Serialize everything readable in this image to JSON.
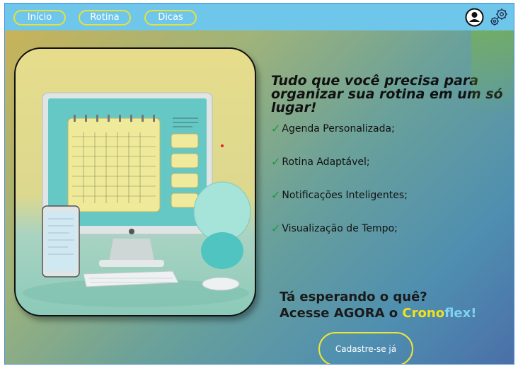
{
  "nav": {
    "items": [
      {
        "label": "Início"
      },
      {
        "label": "Rotina"
      },
      {
        "label": "Dicas"
      }
    ]
  },
  "icons": {
    "user": "user-account-icon",
    "settings": "gear-icon"
  },
  "hero": {
    "headline": "Tudo que você precisa para organizar sua rotina em um só lugar!",
    "features": [
      "Agenda Personalizada;",
      "Rotina Adaptável;",
      "Notificações Inteligentes;",
      "Visualização de Tempo;"
    ],
    "cta_line1": "Tá esperando o quê?",
    "cta_line2_prefix": "Acesse AGORA o ",
    "brand_part1": "Crono",
    "brand_part2": "flex!",
    "signup_label": "Cadastre-se já"
  },
  "colors": {
    "topbar": "#6ec6ea",
    "nav_border": "#e8e13a",
    "check": "#1f9a3c",
    "brand_yellow": "#f2e21b",
    "brand_blue": "#7fd3f0"
  }
}
